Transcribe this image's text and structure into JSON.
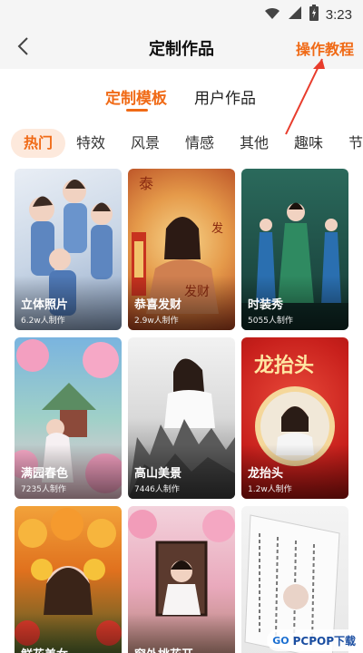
{
  "status_bar": {
    "time": "3:23"
  },
  "nav": {
    "title": "定制作品",
    "tutorial_link": "操作教程"
  },
  "main_tabs": [
    {
      "label": "定制模板",
      "active": true
    },
    {
      "label": "用户作品",
      "active": false
    }
  ],
  "categories": [
    {
      "label": "热门",
      "active": true
    },
    {
      "label": "特效",
      "active": false
    },
    {
      "label": "风景",
      "active": false
    },
    {
      "label": "情感",
      "active": false
    },
    {
      "label": "其他",
      "active": false
    },
    {
      "label": "趣味",
      "active": false
    },
    {
      "label": "节",
      "active": false
    }
  ],
  "templates": [
    {
      "title": "立体照片",
      "count": "6.2w人制作"
    },
    {
      "title": "恭喜发财",
      "count": "2.9w人制作"
    },
    {
      "title": "时装秀",
      "count": "5055人制作"
    },
    {
      "title": "满园春色",
      "count": "7235人制作"
    },
    {
      "title": "高山美景",
      "count": "7446人制作"
    },
    {
      "title": "龙抬头",
      "count": "1.2w人制作"
    },
    {
      "title": "鲜花美女",
      "count": ""
    },
    {
      "title": "窗外桃花开",
      "count": ""
    },
    {
      "title": "",
      "count": ""
    }
  ],
  "card_art": {
    "card5_banner": "龙抬头",
    "card2_text": "恭喜发财"
  },
  "watermark": {
    "left": "GO",
    "right": "PCPOP下载"
  },
  "colors": {
    "accent": "#f06a16",
    "accent_bg": "#fde9dc",
    "nav_bg": "#f5f5f5"
  },
  "icons": [
    "wifi-icon",
    "signal-icon",
    "battery-icon",
    "back-arrow-icon"
  ]
}
